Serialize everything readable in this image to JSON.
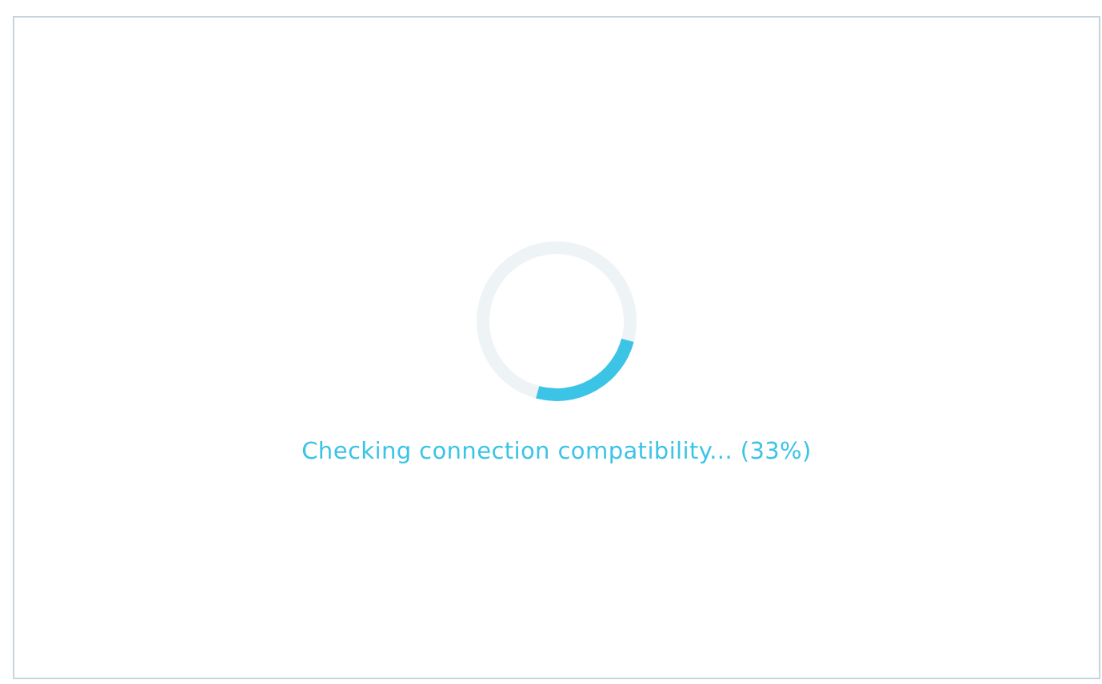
{
  "progress": {
    "message": "Checking connection compatibility... (33%)"
  }
}
